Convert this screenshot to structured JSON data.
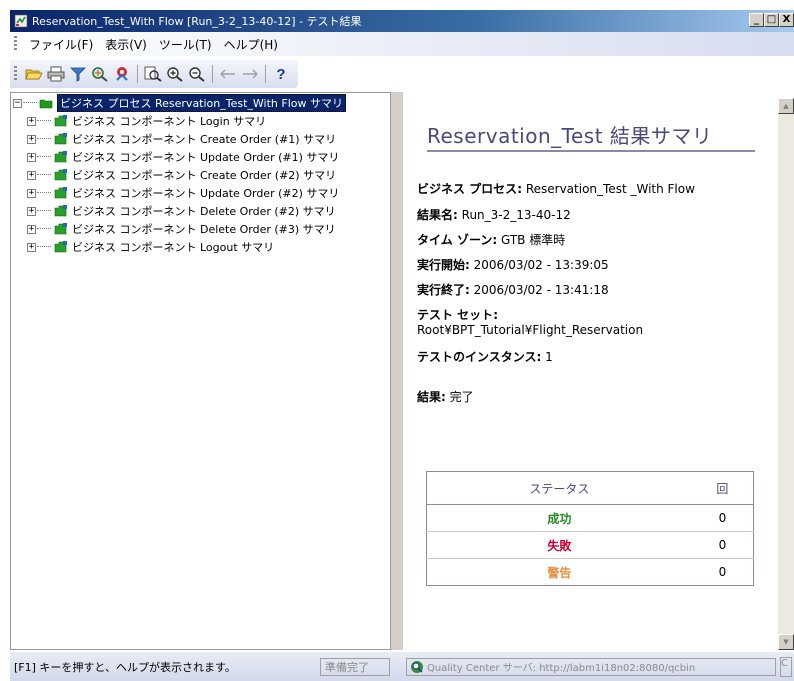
{
  "window": {
    "title": "Reservation_Test_With Flow     [Run_3-2_13-40-12] - テスト結果",
    "min_label": "_",
    "max_label": "□",
    "close_label": "X"
  },
  "menu": {
    "items": [
      "ファイル(F)",
      "表示(V)",
      "ツール(T)",
      "ヘルプ(H)"
    ]
  },
  "toolbar": {
    "icons": [
      "open-folder-icon",
      "print-icon",
      "filter-icon",
      "find-icon",
      "quality-center-icon",
      "zoom-preview-icon",
      "zoom-in-icon",
      "zoom-out-icon",
      "back-icon",
      "forward-icon",
      "help-icon"
    ],
    "help_label": "?"
  },
  "tree": {
    "root": {
      "expander": "−",
      "label": "ビジネス プロセス Reservation_Test_With Flow サマリ"
    },
    "children": [
      {
        "expander": "+",
        "label": "ビジネス コンポーネント Login サマリ"
      },
      {
        "expander": "+",
        "label": "ビジネス コンポーネント Create Order (#1) サマリ"
      },
      {
        "expander": "+",
        "label": "ビジネス コンポーネント Update Order (#1) サマリ"
      },
      {
        "expander": "+",
        "label": "ビジネス コンポーネント Create Order (#2) サマリ"
      },
      {
        "expander": "+",
        "label": "ビジネス コンポーネント Update Order (#2) サマリ"
      },
      {
        "expander": "+",
        "label": "ビジネス コンポーネント Delete Order (#2) サマリ"
      },
      {
        "expander": "+",
        "label": "ビジネス コンポーネント Delete Order (#3) サマリ"
      },
      {
        "expander": "+",
        "label": "ビジネス コンポーネント Logout サマリ"
      }
    ]
  },
  "report": {
    "title": "Reservation_Test 結果サマリ",
    "business_process_label": "ビジネス プロセス",
    "business_process_value": "Reservation_Test _With Flow",
    "result_name_label": "結果名",
    "result_name_value": "Run_3-2_13-40-12",
    "timezone_label": "タイム ゾーン",
    "timezone_value": "GTB 標準時",
    "start_label": "実行開始",
    "start_value": "2006/03/02 - 13:39:05",
    "end_label": "実行終了",
    "end_value": "2006/03/02 - 13:41:18",
    "test_set_label": "テスト セット",
    "test_set_value": "Root¥BPT_Tutorial¥Flight_Reservation",
    "instance_label": "テストのインスタンス",
    "instance_value": "1",
    "result_label": "結果",
    "result_value": "完了",
    "colon": ":"
  },
  "status_table": {
    "header_status": "ステータス",
    "header_count": "回",
    "rows": [
      {
        "status": "成功",
        "count": "0",
        "color": "#228b22"
      },
      {
        "status": "失敗",
        "count": "0",
        "color": "#cc0033"
      },
      {
        "status": "警告",
        "count": "0",
        "color": "#e69040"
      }
    ]
  },
  "statusbar": {
    "help_text": "[F1] キーを押すと、ヘルプが表示されます。",
    "ready_text": "準備完了",
    "qc_text": "Quality Center サーバ: http://labm1i18n02:8080/qcbin",
    "end_text": "C"
  }
}
